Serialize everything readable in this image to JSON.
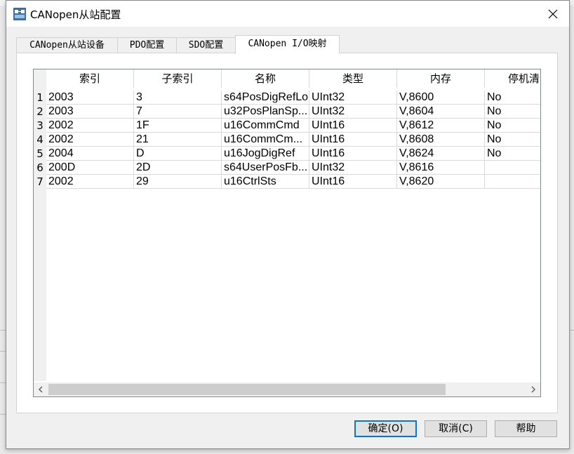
{
  "window": {
    "title": "CANopen从站配置",
    "close_icon": "close-icon",
    "app_icon": "app-icon"
  },
  "tabs": [
    {
      "label": "CANopen从站设备",
      "active": false
    },
    {
      "label": "PDO配置",
      "active": false
    },
    {
      "label": "SDO配置",
      "active": false
    },
    {
      "label": "CANopen I/O映射",
      "active": true
    }
  ],
  "grid": {
    "columns": [
      "索引",
      "子索引",
      "名称",
      "类型",
      "内存",
      "停机清"
    ],
    "rows": [
      {
        "num": "1",
        "cells": [
          "2003",
          "3",
          "s64PosDigRefLo",
          "UInt32",
          "V,8600",
          "No"
        ]
      },
      {
        "num": "2",
        "cells": [
          "2003",
          "7",
          "u32PosPlanSp...",
          "UInt32",
          "V,8604",
          "No"
        ]
      },
      {
        "num": "3",
        "cells": [
          "2002",
          "1F",
          "u16CommCmd",
          "UInt16",
          "V,8612",
          "No"
        ]
      },
      {
        "num": "4",
        "cells": [
          "2002",
          "21",
          "u16CommCm...",
          "UInt16",
          "V,8608",
          "No"
        ]
      },
      {
        "num": "5",
        "cells": [
          "2004",
          "D",
          "u16JogDigRef",
          "UInt16",
          "V,8624",
          "No"
        ]
      },
      {
        "num": "6",
        "cells": [
          "200D",
          "2D",
          "s64UserPosFb...",
          "UInt32",
          "V,8616",
          ""
        ]
      },
      {
        "num": "7",
        "cells": [
          "2002",
          "29",
          "u16CtrlSts",
          "UInt16",
          "V,8620",
          ""
        ]
      }
    ]
  },
  "buttons": {
    "ok": "确定(O)",
    "cancel": "取消(C)",
    "help": "帮助"
  },
  "colors": {
    "accent": "#0078d7",
    "grid_line": "#d9d9d9",
    "scroll_thumb": "#cdcdcd"
  }
}
